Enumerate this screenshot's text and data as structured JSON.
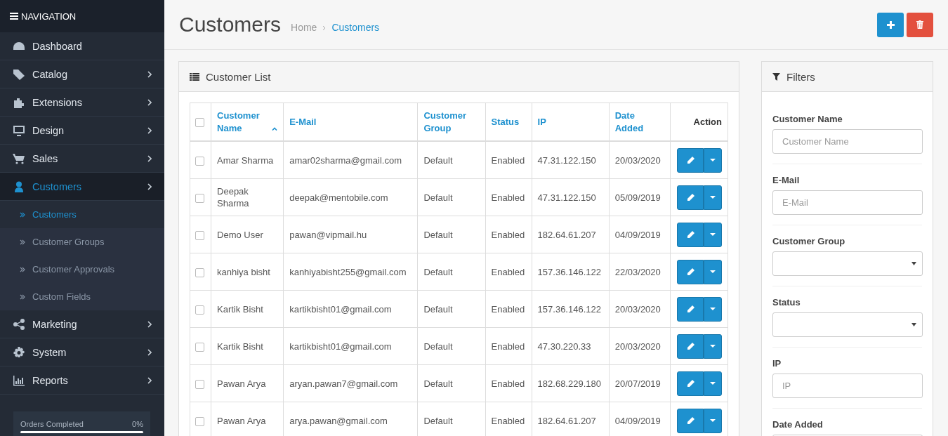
{
  "navigation": {
    "title": "NAVIGATION",
    "items": [
      {
        "label": "Dashboard",
        "expandable": false,
        "selected": false
      },
      {
        "label": "Catalog",
        "expandable": true,
        "selected": false
      },
      {
        "label": "Extensions",
        "expandable": true,
        "selected": false
      },
      {
        "label": "Design",
        "expandable": true,
        "selected": false
      },
      {
        "label": "Sales",
        "expandable": true,
        "selected": false
      },
      {
        "label": "Customers",
        "expandable": true,
        "selected": true,
        "children": [
          {
            "label": "Customers",
            "selected": true
          },
          {
            "label": "Customer Groups",
            "selected": false
          },
          {
            "label": "Customer Approvals",
            "selected": false
          },
          {
            "label": "Custom Fields",
            "selected": false
          }
        ]
      },
      {
        "label": "Marketing",
        "expandable": true,
        "selected": false
      },
      {
        "label": "System",
        "expandable": true,
        "selected": false
      },
      {
        "label": "Reports",
        "expandable": true,
        "selected": false
      }
    ],
    "progress": {
      "label": "Orders Completed",
      "reading": "0%",
      "level": 0
    }
  },
  "page": {
    "title": "Customers",
    "breadcrumb": [
      {
        "label": "Home",
        "selected": false
      },
      {
        "label": "Customers",
        "selected": true
      }
    ]
  },
  "customer_list": {
    "title": "Customer List",
    "all_checked": false,
    "columns": [
      {
        "label": "Customer Name",
        "sorted": true
      },
      {
        "label": "E-Mail",
        "sorted": false
      },
      {
        "label": "Customer Group",
        "sorted": false
      },
      {
        "label": "Status",
        "sorted": false
      },
      {
        "label": "IP",
        "sorted": false
      },
      {
        "label": "Date Added",
        "sorted": false
      },
      {
        "label": "Action",
        "sorted": false
      }
    ],
    "rows": [
      {
        "checked": false,
        "cells": [
          "Amar Sharma",
          "amar02sharma@gmail.com",
          "Default",
          "Enabled",
          "47.31.122.150",
          "20/03/2020"
        ]
      },
      {
        "checked": false,
        "cells": [
          "Deepak Sharma",
          "deepak@mentobile.com",
          "Default",
          "Enabled",
          "47.31.122.150",
          "05/09/2019"
        ]
      },
      {
        "checked": false,
        "cells": [
          "Demo User",
          "pawan@vipmail.hu",
          "Default",
          "Enabled",
          "182.64.61.207",
          "04/09/2019"
        ]
      },
      {
        "checked": false,
        "cells": [
          "kanhiya bisht",
          "kanhiyabisht255@gmail.com",
          "Default",
          "Enabled",
          "157.36.146.122",
          "22/03/2020"
        ]
      },
      {
        "checked": false,
        "cells": [
          "Kartik Bisht",
          "kartikbisht01@gmail.com",
          "Default",
          "Enabled",
          "157.36.146.122",
          "20/03/2020"
        ]
      },
      {
        "checked": false,
        "cells": [
          "Kartik Bisht",
          "kartikbisht01@gmail.com",
          "Default",
          "Enabled",
          "47.30.220.33",
          "20/03/2020"
        ]
      },
      {
        "checked": false,
        "cells": [
          "Pawan Arya",
          "aryan.pawan7@gmail.com",
          "Default",
          "Enabled",
          "182.68.229.180",
          "20/07/2019"
        ]
      },
      {
        "checked": false,
        "cells": [
          "Pawan Arya",
          "arya.pawan@gmail.com",
          "Default",
          "Enabled",
          "182.64.61.207",
          "04/09/2019"
        ]
      }
    ]
  },
  "filters": {
    "title": "Filters",
    "fields": [
      {
        "label": "Customer Name",
        "kind": "text",
        "placeholder": "Customer Name"
      },
      {
        "label": "E-Mail",
        "kind": "text",
        "placeholder": "E-Mail"
      },
      {
        "label": "Customer Group",
        "kind": "select"
      },
      {
        "label": "Status",
        "kind": "select"
      },
      {
        "label": "IP",
        "kind": "text",
        "placeholder": "IP"
      },
      {
        "label": "Date Added",
        "kind": "date"
      }
    ]
  }
}
